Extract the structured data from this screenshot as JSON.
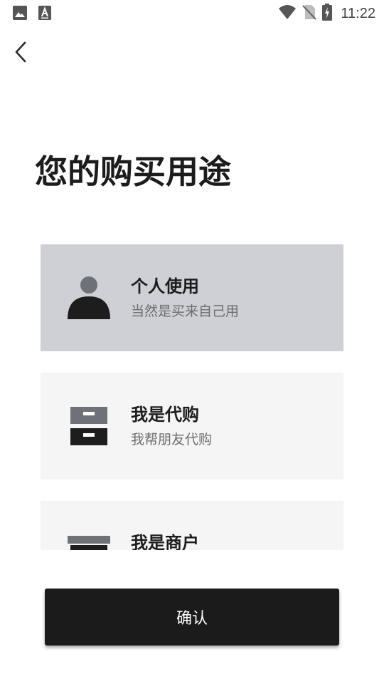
{
  "status_bar": {
    "time": "11:22",
    "left_icons": [
      "gallery-icon",
      "font-a-icon"
    ],
    "right_icons": [
      "wifi-icon",
      "no-sim-icon",
      "battery-charging-icon"
    ]
  },
  "header": {
    "back_icon": "chevron-left-icon"
  },
  "page": {
    "title": "您的购买用途"
  },
  "options": [
    {
      "title": "个人使用",
      "subtitle": "当然是买来自己用",
      "icon": "person-icon",
      "selected": true
    },
    {
      "title": "我是代购",
      "subtitle": "我帮朋友代购",
      "icon": "drawer-cabinet-icon",
      "selected": false
    },
    {
      "title": "我是商户",
      "subtitle": "",
      "icon": "store-shelf-icon",
      "selected": false
    }
  ],
  "footer": {
    "confirm_label": "确认"
  },
  "colors": {
    "selected_card": "#cfd0d6",
    "card": "#f5f5f5",
    "button": "#1b1b1b",
    "subtitle": "#6d6d6d"
  }
}
